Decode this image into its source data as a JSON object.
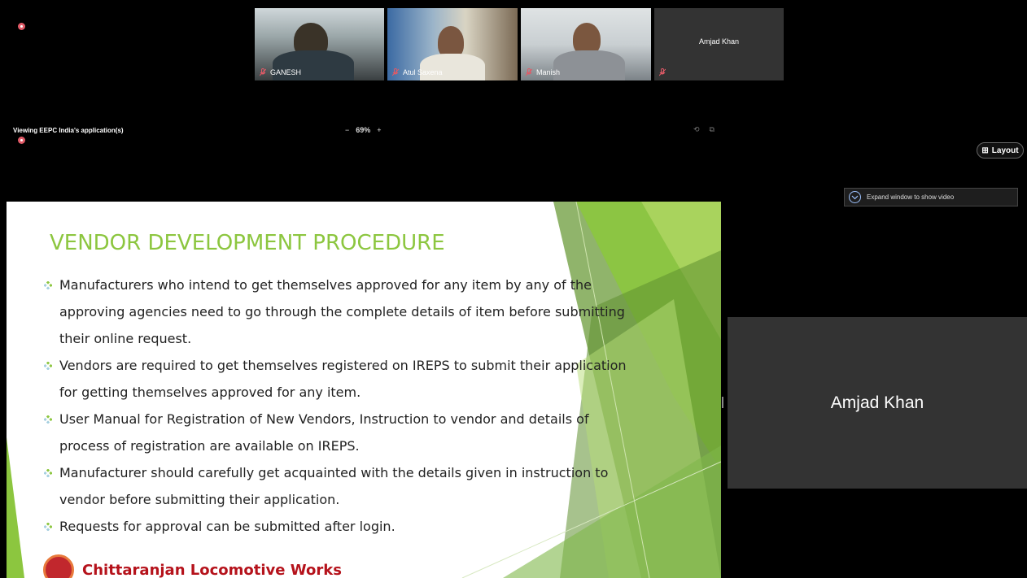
{
  "participants": [
    {
      "name": "GANESH"
    },
    {
      "name": "Atul Saxena"
    },
    {
      "name": "Manish"
    },
    {
      "name": "Amjad Khan",
      "camera_off": true
    }
  ],
  "share_bar": {
    "viewing_text": "Viewing EEPC India's application(s)",
    "zoom_minus": "−",
    "zoom_level": "69%",
    "zoom_plus": "+"
  },
  "layout_button": {
    "label": "Layout"
  },
  "expand_window": {
    "label": "Expand window to show video"
  },
  "slide": {
    "title": "VENDOR DEVELOPMENT PROCEDURE",
    "bullets": [
      "Manufacturers who intend to get themselves approved for any item by any of the approving agencies need to go through the complete details of item before submitting their online request.",
      "Vendors are required to get themselves registered on IREPS to submit their application for getting themselves approved for any item.",
      "User Manual for Registration of New Vendors, Instruction to vendor and details of process of registration are available on IREPS.",
      "Manufacturer should carefully get acquainted with the details given in instruction to vendor before submitting their application.",
      "Requests for approval can be submitted after login."
    ],
    "footer": "Chittaranjan Locomotive Works"
  },
  "side_video": {
    "name": "Amjad Khan"
  },
  "colors": {
    "accent_green": "#8cc63f",
    "recording_red": "#e05a67",
    "mic_muted": "#e05a67",
    "footer_red": "#b5121b"
  }
}
